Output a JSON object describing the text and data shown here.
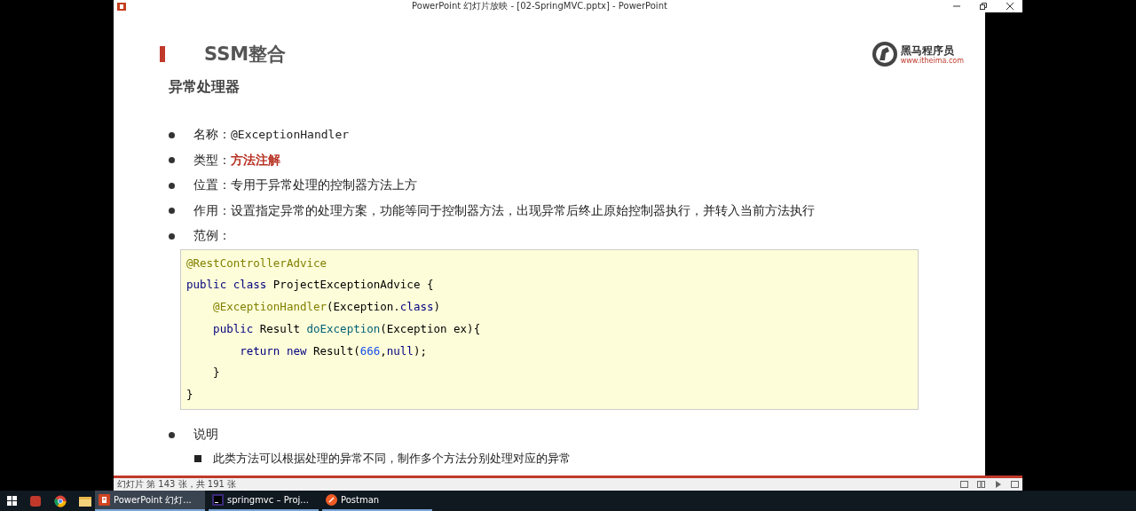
{
  "window": {
    "title": "PowerPoint 幻灯片放映 - [02-SpringMVC.pptx] - PowerPoint"
  },
  "slide": {
    "title": "SSM整合",
    "logo": {
      "name": "黑马程序员",
      "url": "www.itheima.com"
    },
    "subtitle": "异常处理器",
    "bullets": [
      {
        "label": "名称：",
        "value": "@ExceptionHandler",
        "highlight": false,
        "kind": "code"
      },
      {
        "label": "类型：",
        "value": "方法注解",
        "highlight": true,
        "kind": "text"
      },
      {
        "label": "位置：",
        "value": "专用于异常处理的控制器方法上方",
        "highlight": false,
        "kind": "text"
      },
      {
        "label": "作用：",
        "value": "设置指定异常的处理方案，功能等同于控制器方法，出现异常后终止原始控制器执行，并转入当前方法执行",
        "highlight": false,
        "kind": "text"
      },
      {
        "label": "范例："
      }
    ],
    "code": [
      [
        {
          "kind": "annotation",
          "text": "@RestControllerAdvice"
        }
      ],
      [
        {
          "kind": "keyword",
          "text": "public class "
        },
        {
          "kind": "plain",
          "text": "ProjectExceptionAdvice {"
        }
      ],
      [
        {
          "kind": "annotation",
          "text": "    @ExceptionHandler"
        },
        {
          "kind": "plain",
          "text": "(Exception."
        },
        {
          "kind": "keyword",
          "text": "class"
        },
        {
          "kind": "plain",
          "text": ")"
        }
      ],
      [
        {
          "kind": "keyword",
          "text": "    public "
        },
        {
          "kind": "plain",
          "text": "Result "
        },
        {
          "kind": "method",
          "text": "doException"
        },
        {
          "kind": "plain",
          "text": "(Exception ex){"
        }
      ],
      [
        {
          "kind": "keyword",
          "text": "        return new "
        },
        {
          "kind": "plain",
          "text": "Result("
        },
        {
          "kind": "number",
          "text": "666"
        },
        {
          "kind": "plain",
          "text": ","
        },
        {
          "kind": "keyword",
          "text": "null"
        },
        {
          "kind": "plain",
          "text": ");"
        }
      ],
      [
        {
          "kind": "plain",
          "text": "    }"
        }
      ],
      [
        {
          "kind": "plain",
          "text": "}"
        }
      ]
    ],
    "note": {
      "label": "说明",
      "items": [
        "此类方法可以根据处理的异常不同，制作多个方法分别处理对应的异常"
      ]
    }
  },
  "status_bar": {
    "text": "幻灯片 第 143 张，共 191 张"
  },
  "taskbar": {
    "tasks": [
      {
        "label": "PowerPoint 幻灯...",
        "kind": "powerpoint",
        "selected": true
      },
      {
        "label": "springmvc – Proj...",
        "kind": "idea",
        "selected": false
      },
      {
        "label": "Postman",
        "kind": "postman",
        "selected": false
      }
    ]
  }
}
